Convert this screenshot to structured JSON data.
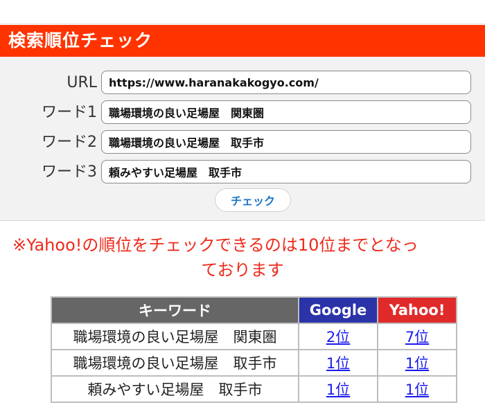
{
  "header": {
    "title": "検索順位チェック"
  },
  "form": {
    "url": {
      "label": "URL",
      "value": "https://www.haranakakogyo.com/"
    },
    "words": [
      {
        "label": "ワード1",
        "value": "職場環境の良い足場屋　関東圏"
      },
      {
        "label": "ワード2",
        "value": "職場環境の良い足場屋　取手市"
      },
      {
        "label": "ワード3",
        "value": "頼みやすい足場屋　取手市"
      }
    ],
    "check_button_label": "チェック"
  },
  "notice": {
    "line1": "※Yahoo!の順位をチェックできるのは10位までとなっ",
    "line2": "ております"
  },
  "results": {
    "headers": {
      "keyword": "キーワード",
      "google": "Google",
      "yahoo": "Yahoo!"
    },
    "rows": [
      {
        "keyword": "職場環境の良い足場屋　関東圏",
        "google": "2位",
        "yahoo": "7位"
      },
      {
        "keyword": "職場環境の良い足場屋　取手市",
        "google": "1位",
        "yahoo": "1位"
      },
      {
        "keyword": "頼みやすい足場屋　取手市",
        "google": "1位",
        "yahoo": "1位"
      }
    ]
  },
  "colors": {
    "header_bg": "#ff3300",
    "google_head_bg": "#2a33a8",
    "yahoo_head_bg": "#e02a2a",
    "keyword_head_bg": "#666666",
    "notice_text": "#ee2a1a",
    "link": "#1a1aee"
  }
}
